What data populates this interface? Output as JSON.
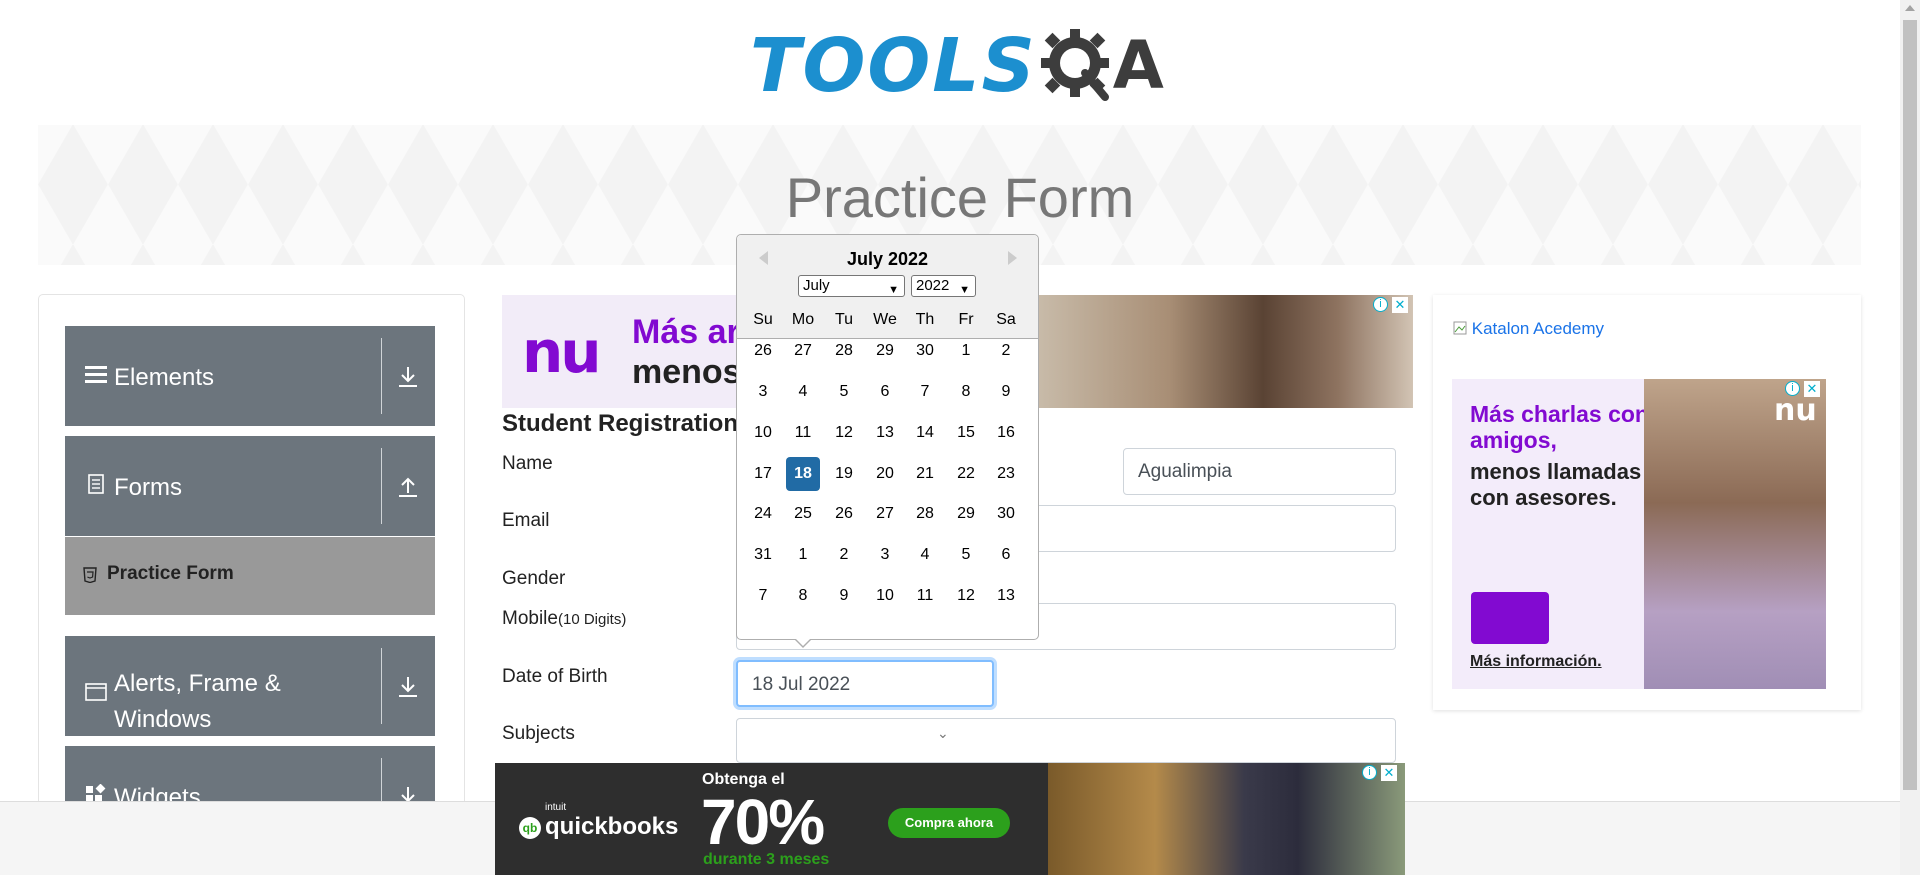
{
  "logo": {
    "text_tools": "TOOLS",
    "text_a": "A"
  },
  "banner": {
    "title": "Practice Form"
  },
  "sidebar": {
    "groups": [
      {
        "label": "Elements",
        "icon": "list-icon",
        "arrow": "download-icon"
      },
      {
        "label": "Forms",
        "icon": "document-icon",
        "arrow": "upload-icon"
      },
      {
        "label": "Alerts, Frame & Windows",
        "icon": "window-icon",
        "arrow": "download-icon"
      },
      {
        "label": "Widgets",
        "icon": "widgets-icon",
        "arrow": "download-icon"
      }
    ],
    "active_item": "Practice Form"
  },
  "ad_top": {
    "logo": "nu",
    "line1": "Más ar",
    "line2": "menos"
  },
  "form": {
    "heading": "Student Registration",
    "name_label": "Name",
    "last_name_value": "Agualimpia",
    "email_label": "Email",
    "gender_label": "Gender",
    "mobile_label": "Mobile",
    "mobile_hint": "(10 Digits)",
    "dob_label": "Date of Birth",
    "dob_value": "18 Jul 2022",
    "subjects_label": "Subjects"
  },
  "datepicker": {
    "title": "July 2022",
    "month_select": "July",
    "year_select": "2022",
    "weekdays": [
      "Su",
      "Mo",
      "Tu",
      "We",
      "Th",
      "Fr",
      "Sa"
    ],
    "weeks": [
      [
        "26",
        "27",
        "28",
        "29",
        "30",
        "1",
        "2"
      ],
      [
        "3",
        "4",
        "5",
        "6",
        "7",
        "8",
        "9"
      ],
      [
        "10",
        "11",
        "12",
        "13",
        "14",
        "15",
        "16"
      ],
      [
        "17",
        "18",
        "19",
        "20",
        "21",
        "22",
        "23"
      ],
      [
        "24",
        "25",
        "26",
        "27",
        "28",
        "29",
        "30"
      ],
      [
        "31",
        "1",
        "2",
        "3",
        "4",
        "5",
        "6"
      ],
      [
        "7",
        "8",
        "9",
        "10",
        "11",
        "12",
        "13"
      ]
    ],
    "selected_day": "18"
  },
  "ad_right": {
    "broken_image_alt": "Katalon Acedemy",
    "headline": "Más charlas con amigos,",
    "subline": "menos llamadas con asesores.",
    "cta": "Más información.",
    "logo": "nu"
  },
  "ad_bottom": {
    "brand": "quickbooks",
    "brand_prefix": "intuit",
    "line1": "Obtenga el",
    "percent": "70%",
    "line2": "durante 3 meses",
    "cta": "Compra ahora"
  },
  "colors": {
    "brand_blue": "#1c8fcf",
    "sidebar_gray": "#6c757d",
    "selected_day": "#216ba5",
    "nu_purple": "#820ad1"
  }
}
